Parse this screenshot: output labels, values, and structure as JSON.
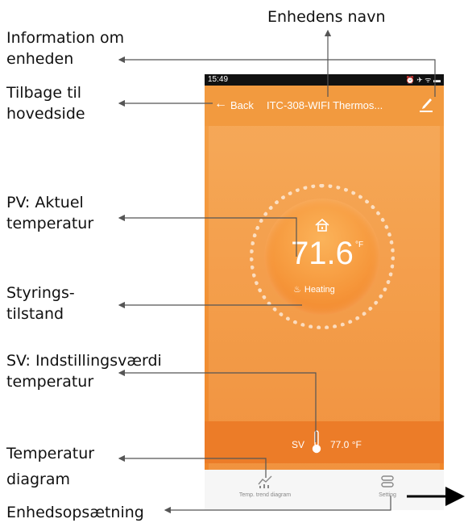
{
  "annotations": {
    "device_name": "Enhedens navn",
    "device_info": "Information om\nenheden",
    "back_home": "Tilbage til\nhovedside",
    "pv": "PV: Aktuel\ntemperatur",
    "control_state": "Styrings-\ntilstand",
    "sv": "SV: Indstillingsværdi\ntemperatur",
    "temp_diagram": "Temperatur\ndiagram",
    "device_setup": "Enhedsopsætning"
  },
  "statusbar": {
    "time": "15:49",
    "icons": "⏰ ✈ ᯤ ▬"
  },
  "navbar": {
    "back_icon": "←",
    "back_label": "Back",
    "title": "ITC-308-WIFI Thermos..."
  },
  "dial": {
    "pv_value": "71.6",
    "pv_unit": "°F",
    "mode_icon": "♨",
    "mode": "Heating"
  },
  "sv": {
    "label": "SV",
    "value": "77.0 °F"
  },
  "bottom_nav": {
    "trend_label": "Temp. trend diagram",
    "setting_label": "Setting"
  },
  "colors": {
    "accent": "#f29a3f",
    "sv_bar": "#ec7c28"
  },
  "icons": [
    "arrow-left-icon",
    "edit-icon",
    "home-icon",
    "heating-icon",
    "thermometer-icon",
    "trend-chart-icon",
    "settings-icon"
  ]
}
